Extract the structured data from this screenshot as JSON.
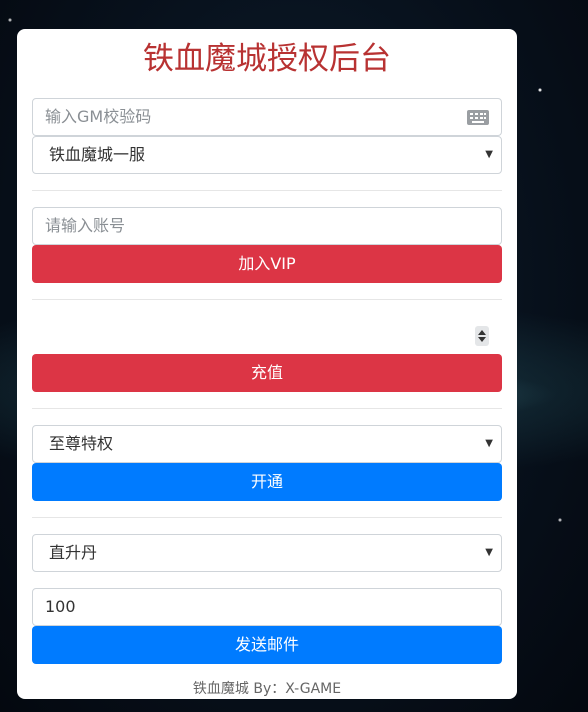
{
  "page": {
    "title": "铁血魔城授权后台",
    "footer": "铁血魔城 By：X-GAME"
  },
  "gm_code": {
    "placeholder": "输入GM校验码",
    "icon": "keyboard-icon"
  },
  "server_select": {
    "selected": "铁血魔城一服"
  },
  "vip_section": {
    "account_placeholder": "请输入账号",
    "button_label": "加入VIP"
  },
  "recharge_section": {
    "amount_value": "",
    "button_label": "充值"
  },
  "privilege_section": {
    "selected": "至尊特权",
    "button_label": "开通"
  },
  "mail_section": {
    "item_selected": "直升丹",
    "quantity_value": "100",
    "button_label": "发送邮件"
  },
  "colors": {
    "title": "#b83232",
    "danger": "#dc3545",
    "primary": "#007bff"
  }
}
